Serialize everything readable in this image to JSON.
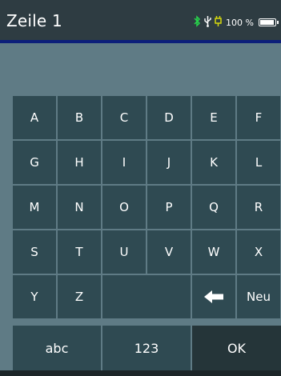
{
  "header": {
    "title": "Zeile 1",
    "battery_percent": "100 %",
    "battery_level": 1.0,
    "icons": [
      "bluetooth-icon",
      "usb-icon",
      "power-plug-icon",
      "battery-icon"
    ]
  },
  "input": {
    "value": ""
  },
  "keyboard": {
    "rows": [
      [
        "A",
        "B",
        "C",
        "D",
        "E",
        "F"
      ],
      [
        "G",
        "H",
        "I",
        "J",
        "K",
        "L"
      ],
      [
        "M",
        "N",
        "O",
        "P",
        "Q",
        "R"
      ],
      [
        "S",
        "T",
        "U",
        "V",
        "W",
        "X"
      ],
      [
        "Y",
        "Z",
        "",
        "",
        "",
        "Neu"
      ]
    ],
    "backspace_icon": "arrow-left-icon"
  },
  "bottom_bar": {
    "abc_label": "abc",
    "num_label": "123",
    "ok_label": "OK"
  },
  "colors": {
    "header_bg": "#2e3c42",
    "accent_bar": "#0c1f7a",
    "panel_bg": "#5f7b85",
    "key_bg": "#2f4a52",
    "bluetooth": "#27d74b",
    "usb": "#ffffff",
    "plug": "#d6d90c"
  }
}
